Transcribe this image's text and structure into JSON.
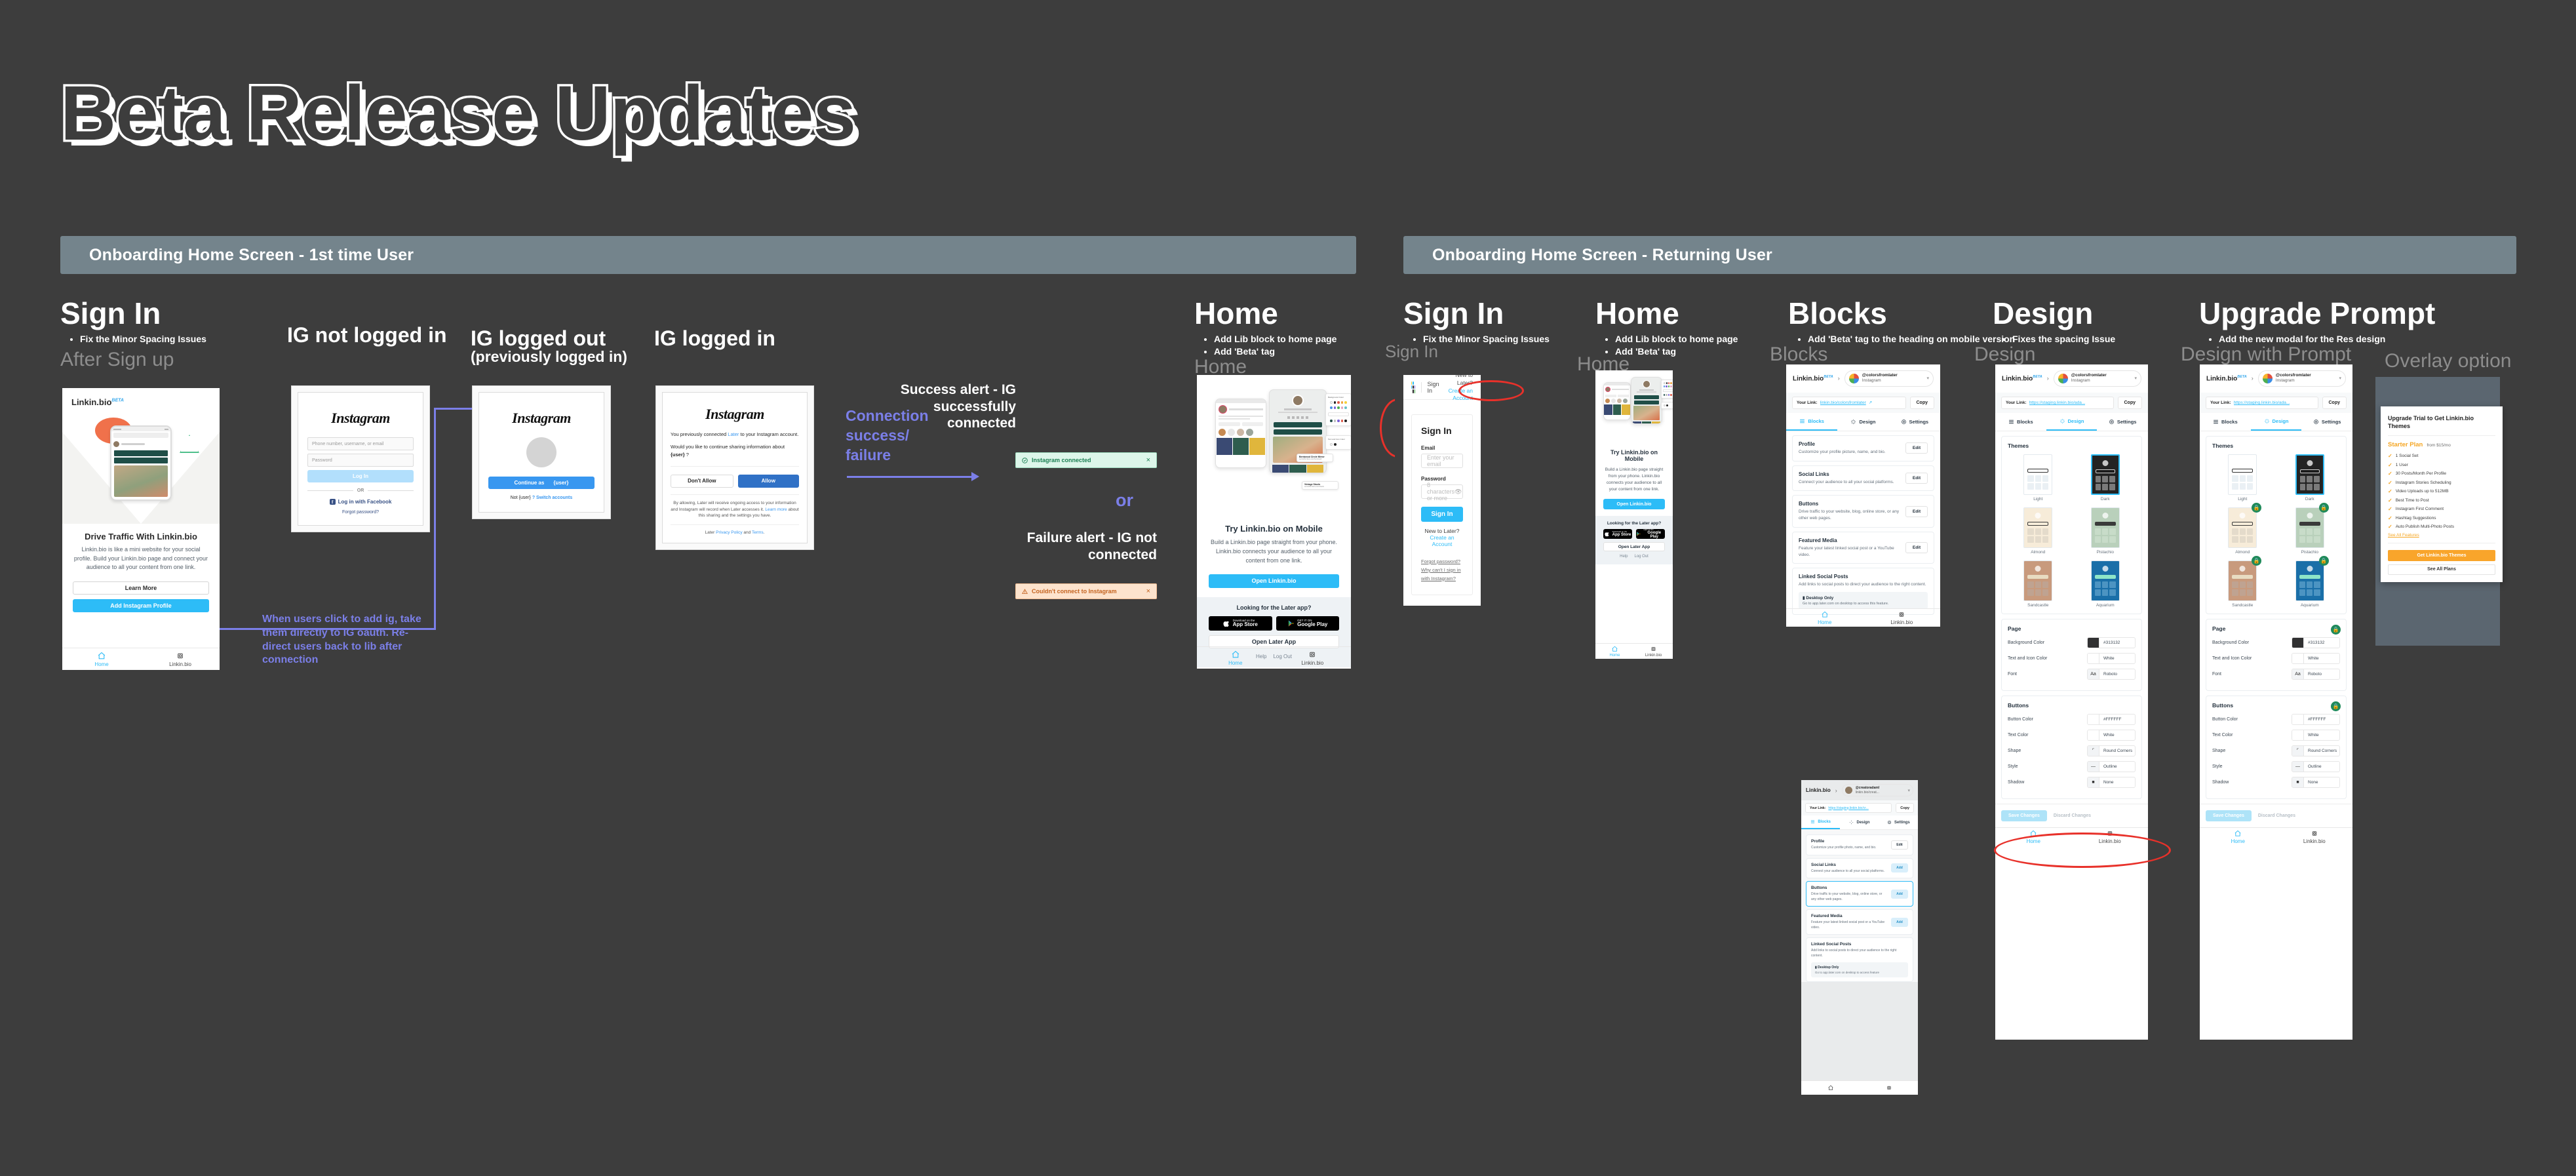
{
  "page": {
    "title": "Beta Release Updates",
    "background_color": "#3d3d3d",
    "banner_color": "#74848c",
    "accent_blue": "#2dbcf7",
    "annotation_purple": "#7b7fe8",
    "annotation_red": "#e8312a"
  },
  "sections": [
    {
      "id": "s1",
      "label": "Onboarding Home Screen - 1st time User"
    },
    {
      "id": "s2",
      "label": "Onboarding Home Screen - Returning User"
    }
  ],
  "columns": {
    "signin_first": {
      "heading": "Sign In",
      "bullets": [
        "Fix the Minor Spacing Issues"
      ],
      "ghost": "After Sign up"
    },
    "ig_not_logged_in": {
      "heading": "IG not logged in"
    },
    "ig_logged_out": {
      "heading": "IG logged out",
      "sub": "(previously logged in)"
    },
    "ig_logged_in": {
      "heading": "IG logged in"
    },
    "home_first": {
      "heading": "Home",
      "bullets": [
        "Add Lib block to home page",
        "Add 'Beta' tag"
      ],
      "ghost": "Home"
    },
    "signin_returning": {
      "heading": "Sign In",
      "bullets": [
        "Fix the Minor Spacing Issues"
      ],
      "ghost": "Sign In"
    },
    "home_returning": {
      "heading": "Home",
      "bullets": [
        "Add Lib block to home page",
        "Add 'Beta' tag"
      ],
      "ghost": "Home"
    },
    "blocks": {
      "heading": "Blocks",
      "bullets": [
        "Add 'Beta' tag to the heading on mobile version"
      ],
      "ghost": "Blocks"
    },
    "design": {
      "heading": "Design",
      "bullets": [
        "Fixes the spacing Issue"
      ],
      "ghost": "Design"
    },
    "upgrade": {
      "heading": "Upgrade Prompt",
      "bullets": [
        "Add the new modal for the Res design"
      ],
      "ghost": "Design with Prompt",
      "ghost2": "Overlay option"
    }
  },
  "annotations": {
    "oauth_note": "When users click to add ig, take them directly to IG oauth. Re-direct users back to lib after connection",
    "connection_label": "Connection success/ failure",
    "success_title": "Success alert - IG successfully connected",
    "or": "or",
    "failure_title": "Failure alert - IG not connected"
  },
  "alerts": {
    "success": {
      "text": "Instagram connected",
      "icon": "check-circle-icon",
      "close": "×"
    },
    "failure": {
      "text": "Couldn't connect to Instagram",
      "icon": "warning-triangle-icon",
      "close": "×"
    }
  },
  "linkinbio_signin_phone": {
    "logo": "Linkin.bio",
    "logo_tag": "BETA",
    "headline": "Drive Traffic With Linkin.bio",
    "body": "Linkin.bio is like a mini website for your social profile. Build your Linkin.bio page and connect your audience to all your content from one link.",
    "learn_more": "Learn More",
    "add_ig": "Add Instagram Profile",
    "tabs": [
      "Home",
      "Linkin.bio"
    ]
  },
  "instagram_login": {
    "wordmark": "Instagram",
    "username_placeholder": "Phone number, username, or email",
    "password_placeholder": "Password",
    "login_button": "Log In",
    "or": "OR",
    "facebook": "Log in with Facebook",
    "forgot": "Forgot password?"
  },
  "instagram_logged_out": {
    "wordmark": "Instagram",
    "continue_label": "Continue as",
    "continue_user": "{user}",
    "not_label": "Not",
    "not_user": "{user}",
    "switch": "? Switch accounts"
  },
  "instagram_permission": {
    "wordmark": "Instagram",
    "line1_pre": "You previously connected ",
    "line1_link": "Later",
    "line1_post": " to your Instagram account.",
    "line2_pre": "Would you like to continue sharing information about ",
    "line2_user": "{user}",
    "line2_post": " ?",
    "deny": "Don't Allow",
    "allow": "Allow",
    "fine_pre": "By allowing, Later will receive ongoing access to your information and Instagram will record when Later accesses it. ",
    "fine_link": "Learn more",
    "fine_post": " about this sharing and the settings you have.",
    "terms_pre": "Later ",
    "terms_link1": "Privacy Policy",
    "terms_mid": " and ",
    "terms_link2": "Terms",
    "terms_post": "."
  },
  "home_phone": {
    "headline": "Try Linkin.bio on Mobile",
    "body": "Build a Linkin.bio page straight from your phone. Linkin.bio connects your audience to all your content from one link.",
    "cta": "Open Linkin.bio",
    "footer_label": "Looking for the Later app?",
    "appstore_small": "Download on the",
    "appstore_big": "App Store",
    "googleplay_small": "GET IT ON",
    "googleplay_big": "Google Play",
    "open_later": "Open Later App",
    "help": "Help",
    "logout": "Log Out",
    "tabs": [
      "Home",
      "Linkin.bio"
    ]
  },
  "signin_web": {
    "nav_signin": "Sign In",
    "nav_new": "New to Later?",
    "nav_create": "Create an Account",
    "title": "Sign In",
    "email_label": "Email",
    "email_placeholder": "Enter your email",
    "password_label": "Password",
    "password_placeholder": "8 characters or more",
    "submit": "Sign In",
    "new_text": "New to Later?",
    "create_link": "Create an Account",
    "forgot": "Forgot password?",
    "why": "Why can't I sign in with Instagram?"
  },
  "blocks_phone": {
    "logo": "Linkin.bio",
    "logo_tag": "BETA",
    "account_name": "@colorsfromlater",
    "account_sub": "Instagram",
    "link_label": "Your Link:",
    "link_value": "linkin.bio/colorsfromlater",
    "copy": "Copy",
    "tabs": [
      {
        "label": "Blocks",
        "icon": "blocks-icon",
        "active": true
      },
      {
        "label": "Design",
        "icon": "design-icon",
        "active": false
      },
      {
        "label": "Settings",
        "icon": "gear-icon",
        "active": false
      }
    ],
    "cards": [
      {
        "title": "Profile",
        "desc": "Customize your profile picture, name, and bio.",
        "action": "Edit",
        "style": "edit"
      },
      {
        "title": "Social Links",
        "desc": "Connect your audience to all your social platforms.",
        "action": "Edit",
        "style": "edit"
      },
      {
        "title": "Buttons",
        "desc": "Drive traffic to your website, blog, online store, or any other web pages.",
        "action": "Edit",
        "style": "edit"
      },
      {
        "title": "Featured Media",
        "desc": "Feature your latest linked social post or a YouTube video.",
        "action": "Edit",
        "style": "edit"
      },
      {
        "title": "Linked Social Posts",
        "desc": "Add links to social posts to direct your audience to the right content.",
        "desktop_title": "Desktop Only",
        "desktop_desc": "Go to app.later.com on desktop to access this feature."
      }
    ],
    "tabbar": [
      "Home",
      "Linkin.bio"
    ]
  },
  "blocks_phone_small": {
    "logo": "Linkin.bio",
    "account_name": "@creatoradaml",
    "account_sub": "linkin.bio/creat...",
    "link_label": "Your Link:",
    "link_value": "https://staging.linkin.bio/cr...",
    "copy": "Copy",
    "tabs": [
      {
        "label": "Blocks",
        "active": true
      },
      {
        "label": "Design",
        "active": false
      },
      {
        "label": "Settings",
        "active": false
      }
    ],
    "cards": [
      {
        "title": "Profile",
        "desc": "Customize your profile photo, name, and bio.",
        "action": "Edit",
        "style": "edit"
      },
      {
        "title": "Social Links",
        "desc": "Connect your audience to all your social platforms.",
        "action": "Add",
        "style": "add"
      },
      {
        "title": "Buttons",
        "desc": "Drive traffic to your website, blog, online store, or any other web pages.",
        "action": "Add",
        "style": "add",
        "highlight": true
      },
      {
        "title": "Featured Media",
        "desc": "Feature your latest linked social post or a YouTube video.",
        "action": "Add",
        "style": "add"
      },
      {
        "title": "Linked Social Posts",
        "desc": "Add links to social posts to direct your audience to the right content.",
        "desktop_title": "Desktop Only",
        "desktop_desc": "Go to app.later.com on desktop to access feature"
      }
    ]
  },
  "design_phone": {
    "logo": "Linkin.bio",
    "logo_tag": "BETA",
    "account_name": "@colorsfromlater",
    "account_sub": "Instagram",
    "link_label": "Your Link:",
    "link_value": "https://staging.linkin.bio/ada...",
    "copy": "Copy",
    "tabs": [
      {
        "label": "Blocks",
        "active": false
      },
      {
        "label": "Design",
        "active": true
      },
      {
        "label": "Settings",
        "active": false
      }
    ],
    "themes_title": "Themes",
    "themes": [
      {
        "name": "Light",
        "bg": "#ffffff",
        "bar": "#ffffff",
        "bar_border": "#333333",
        "cell": "#eaf0f4",
        "selected": false,
        "locked": false
      },
      {
        "name": "Dark",
        "bg": "#232323",
        "bar": "#1b1b1b",
        "bar_border": "#cfcfcf",
        "cell": "#7a7a7a",
        "selected": true,
        "locked": false
      },
      {
        "name": "Almond",
        "bg": "#f7ecd9",
        "bar": "#f7ecd9",
        "bar_border": "#3a3a3a",
        "cell": "#e4dbcb",
        "selected": false,
        "locked": false
      },
      {
        "name": "Pistachio",
        "bg": "#b9d0bb",
        "bar": "#3a3a3a",
        "bar_border": "#3a3a3a",
        "cell": "#c8dcc9",
        "selected": false,
        "locked": false
      },
      {
        "name": "Sandcastle",
        "bg": "#c89a7d",
        "bar": "#e8dcc2",
        "bar_border": "#e8dcc2",
        "cell": "#bfa391",
        "selected": false,
        "locked": false
      },
      {
        "name": "Aquarium",
        "bg": "#1a6fa8",
        "bar": "#8ee6c8",
        "bar_border": "#8ee6c8",
        "cell": "#4c94c2",
        "selected": false,
        "locked": false
      }
    ],
    "page_title": "Page",
    "page_rows": [
      {
        "label": "Background Color",
        "value": "#313132",
        "swatch": "#313132",
        "swatch_kind": "color"
      },
      {
        "label": "Text and Icon Color",
        "value": "White",
        "swatch": "#ffffff",
        "swatch_kind": "color"
      },
      {
        "label": "Font",
        "value": "Roboto",
        "swatch": "Aa",
        "swatch_kind": "glyph"
      }
    ],
    "buttons_title": "Buttons",
    "button_rows": [
      {
        "label": "Button Color",
        "value": "#FFFFFF",
        "swatch": "#ffffff",
        "swatch_kind": "color"
      },
      {
        "label": "Text Color",
        "value": "White",
        "swatch": "#ffffff",
        "swatch_kind": "color"
      },
      {
        "label": "Shape",
        "value": "Round Corners",
        "swatch": "⌜",
        "swatch_kind": "glyph"
      },
      {
        "label": "Style",
        "value": "Outline",
        "swatch": "—",
        "swatch_kind": "glyph"
      },
      {
        "label": "Shadow",
        "value": "None",
        "swatch": "■",
        "swatch_kind": "glyph"
      }
    ],
    "save": "Save Changes",
    "discard": "Discard Changes",
    "tabbar": [
      "Home",
      "Linkin.bio"
    ]
  },
  "upgrade_modal": {
    "title": "Upgrade Trial to Get Linkin.bio Themes",
    "plan_name": "Starter Plan",
    "plan_price": "from $15/mo",
    "features": [
      "1 Social Set",
      "1 User",
      "30 Posts/Month Per Profile",
      "Instagram Stories Scheduling",
      "Video Uploads up to 512MB",
      "Best Time to Post",
      "Instagram First Comment",
      "Hashtag Suggestions",
      "Auto Publish Multi-Photo Posts"
    ],
    "see_all_features": "See All Features",
    "cta": "Get Linkin.bio Themes",
    "secondary": "See All Plans"
  }
}
